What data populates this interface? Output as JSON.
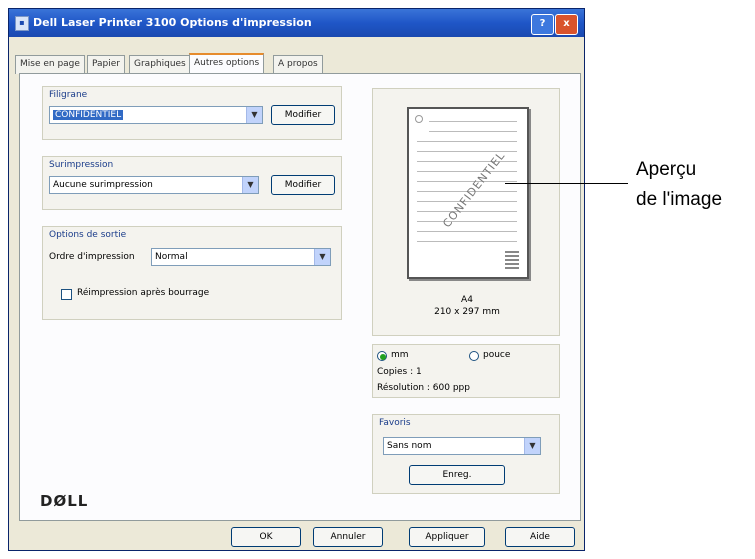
{
  "window": {
    "title": "Dell Laser Printer 3100 Options d'impression",
    "help_label": "?",
    "close_label": "x"
  },
  "tabs": [
    {
      "label": "Mise en page"
    },
    {
      "label": "Papier"
    },
    {
      "label": "Graphiques"
    },
    {
      "label": "Autres options"
    },
    {
      "label": "A propos"
    }
  ],
  "watermark": {
    "group_label": "Filigrane",
    "value": "CONFIDENTIEL",
    "edit_label": "Modifier"
  },
  "overlay": {
    "group_label": "Surimpression",
    "value": "Aucune surimpression",
    "edit_label": "Modifier"
  },
  "output": {
    "group_label": "Options de sortie",
    "order_label": "Ordre d'impression",
    "order_value": "Normal",
    "reprint_label": "Réimpression après bourrage"
  },
  "logo": {
    "text": "DØLL"
  },
  "preview": {
    "watermark_text": "CONFIDENTIEL",
    "paper_name": "A4",
    "paper_size": "210 x 297 mm"
  },
  "info": {
    "mm_label": "mm",
    "inch_label": "pouce",
    "copies": "Copies : 1",
    "resolution": "Résolution : 600 ppp"
  },
  "favorites": {
    "group_label": "Favoris",
    "value": "Sans nom",
    "save_label": "Enreg."
  },
  "footer": {
    "ok_label": "OK",
    "cancel_label": "Annuler",
    "apply_label": "Appliquer",
    "help_label": "Aide"
  },
  "callout": {
    "line1": "Aperçu",
    "line2": "de l'image"
  }
}
